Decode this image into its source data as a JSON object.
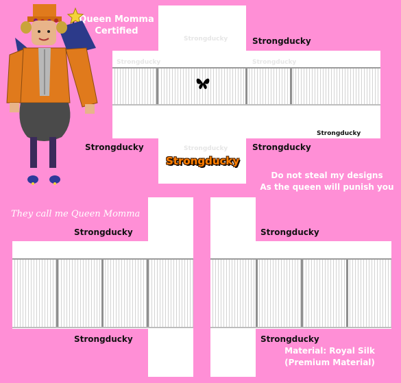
{
  "header_text": {
    "line1": "Queen Momma",
    "line2": "Certified"
  },
  "warning": {
    "line1": "Do not steal my designs",
    "line2": "As the queen will punish you"
  },
  "tagline": "They call me Queen Momma",
  "material": {
    "line1": "Material: Royal Silk",
    "line2": "(Premium Material)"
  },
  "brand": "Strongducky",
  "logo_text": "Strongducky",
  "watermark": "Strongducky",
  "icon": "butterfly-icon",
  "colors": {
    "background": "#ff8fd6",
    "logo": "#ff7f00",
    "character_jacket": "#e07a1c"
  }
}
